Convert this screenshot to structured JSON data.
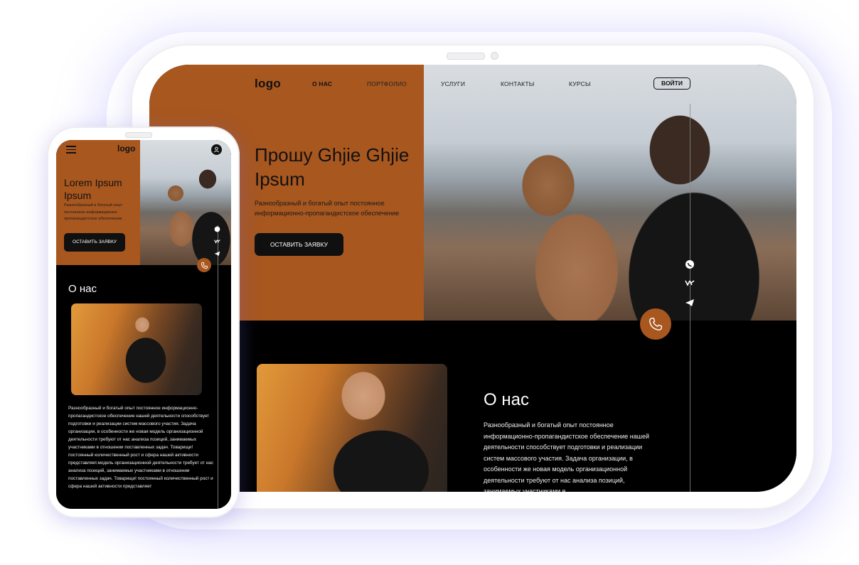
{
  "tablet": {
    "nav": {
      "logo": "logo",
      "items": [
        "О НАС",
        "ПОРТФОЛИО",
        "УСЛУГИ",
        "КОНТАКТЫ",
        "КУРСЫ"
      ],
      "login": "ВОЙТИ"
    },
    "hero": {
      "title": "Прошу Ghjie Ghjie Ipsum",
      "description": "Разнообразный и богатый опыт постоянное информационно-пропагандистское обеспечение",
      "cta": "ОСТАВИТЬ ЗАЯВКУ"
    },
    "social_icons": [
      "whatsapp-icon",
      "vk-icon",
      "telegram-icon"
    ],
    "about": {
      "title": "О нас",
      "text": "Разнообразный и богатый опыт постоянное информационно-пропагандистское обеспечение нашей деятельности способствует подготовки и реализации систем массового участия. Задача организации, в особенности же новая модель организационной деятельности требуют от нас анализа позиций, занимаемых участниками в"
    }
  },
  "phone": {
    "logo": "logo",
    "hero": {
      "title": "Lorem Ipsum Ipsum",
      "description": "Разнообразный и богатый опыт постоянное информационно-пропагандистское обеспечение",
      "cta": "ОСТАВИТЬ ЗАЯВКУ"
    },
    "about": {
      "title": "О нас",
      "text": "Разнообразный и богатый опыт постоянное информационно-пропагандистское обеспечение нашей деятельности способствует подготовки и реализации систем массового участия. Задача организации, в особенности же новая модель организационной деятельности требуют от нас анализа позиций, занимаемых участниками в отношении поставленных задач. Товарищи! постоянный количественный рост и сфера нашей активности представляет.модель организационной деятельности требует от нас анализа позиций, занимаемых участниками в отношении поставленных задач. Товарищи! постоянный количественный рост и сфера нашей активности представляет"
    }
  },
  "colors": {
    "accent": "#a8571f",
    "dark": "#000000",
    "button": "#101010"
  }
}
